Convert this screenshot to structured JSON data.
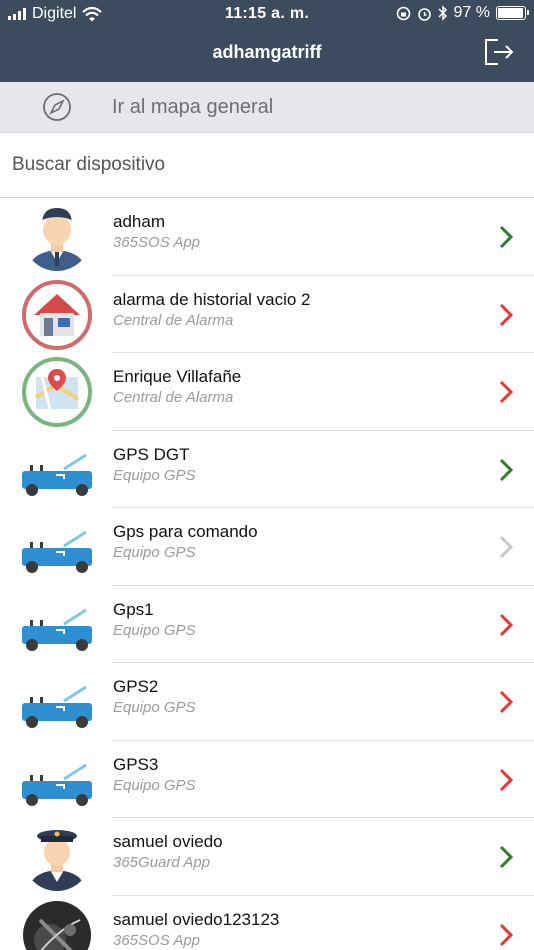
{
  "status_bar": {
    "carrier": "Digitel",
    "time": "11:15 a. m.",
    "battery": "97 %",
    "battery_level": 0.97
  },
  "header": {
    "title": "adhamgatriff"
  },
  "map_link": {
    "label": "Ir al mapa general"
  },
  "search": {
    "placeholder": "Buscar dispositivo"
  },
  "colors": {
    "header_bg": "#3d4b5e",
    "chevron_green": "#2e7d32",
    "chevron_red": "#e53935",
    "chevron_gray": "#c7c7cc"
  },
  "devices": [
    {
      "name": "adham",
      "type": "365SOS App",
      "icon": "user-avatar-icon",
      "status_color": "#2e7d32"
    },
    {
      "name": "alarma de historial vacio 2",
      "type": "Central de Alarma",
      "icon": "house-icon",
      "status_color": "#e53935"
    },
    {
      "name": "Enrique Villafañe",
      "type": "Central de Alarma",
      "icon": "map-pin-icon",
      "status_color": "#e53935"
    },
    {
      "name": "GPS DGT",
      "type": "Equipo GPS",
      "icon": "car-icon",
      "status_color": "#2e7d32"
    },
    {
      "name": "Gps para comando",
      "type": "Equipo GPS",
      "icon": "car-icon",
      "status_color": "#c7c7cc"
    },
    {
      "name": "Gps1",
      "type": "Equipo GPS",
      "icon": "car-icon",
      "status_color": "#e53935"
    },
    {
      "name": "GPS2",
      "type": "Equipo GPS",
      "icon": "car-icon",
      "status_color": "#e53935"
    },
    {
      "name": "GPS3",
      "type": "Equipo GPS",
      "icon": "car-icon",
      "status_color": "#e53935"
    },
    {
      "name": "samuel oviedo",
      "type": "365Guard App",
      "icon": "guard-avatar-icon",
      "status_color": "#2e7d32"
    },
    {
      "name": "samuel oviedo123123",
      "type": "365SOS App",
      "icon": "photo-avatar-icon",
      "status_color": "#e53935"
    }
  ]
}
